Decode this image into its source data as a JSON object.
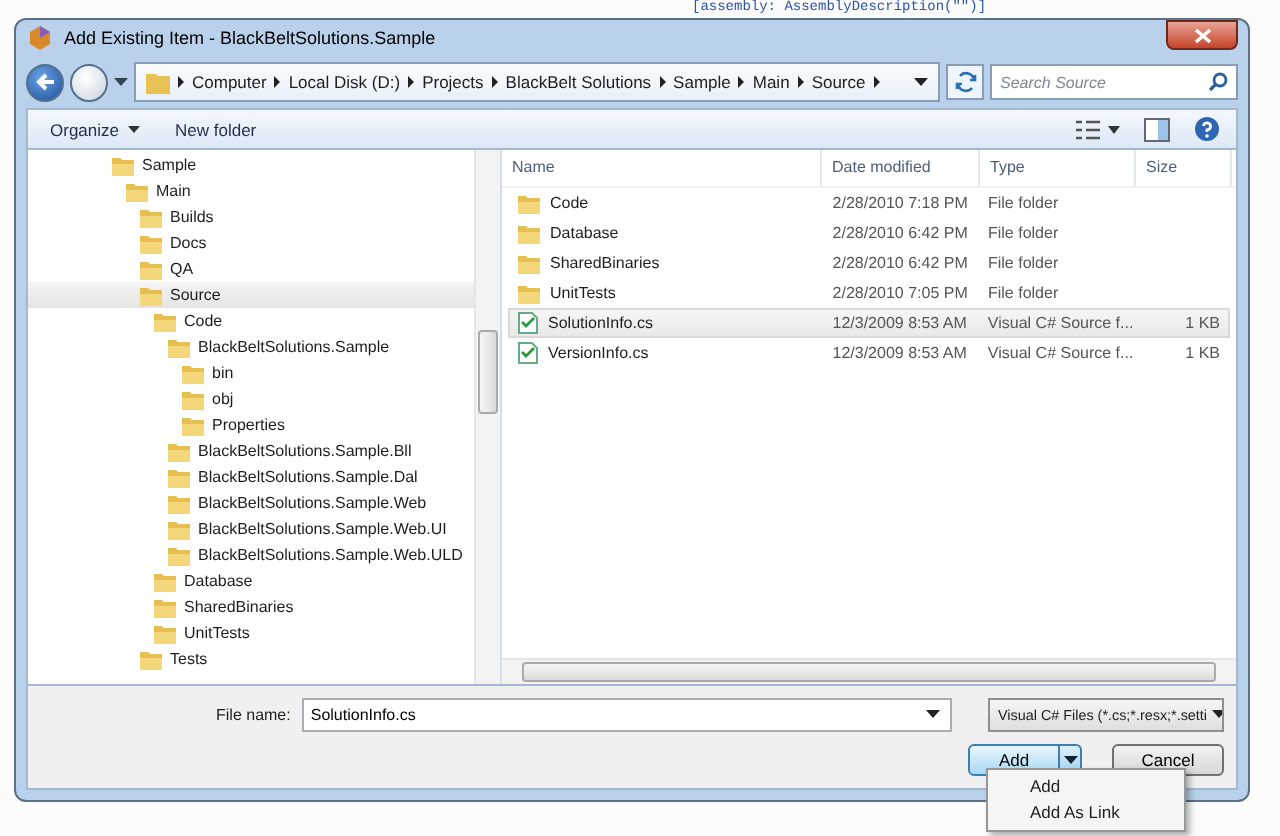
{
  "editor_line": "[assembly: AssemblyDescription(\"\")]",
  "window": {
    "title": "Add Existing Item - BlackBeltSolutions.Sample"
  },
  "breadcrumbs": [
    "Computer",
    "Local Disk (D:)",
    "Projects",
    "BlackBelt Solutions",
    "Sample",
    "Main",
    "Source"
  ],
  "search": {
    "placeholder": "Search Source"
  },
  "toolbar": [
    "Organize",
    "New folder"
  ],
  "tree": [
    {
      "label": "Sample",
      "selected": false,
      "children": [
        {
          "label": "Main",
          "selected": false,
          "children": [
            {
              "label": "Builds",
              "selected": false
            },
            {
              "label": "Docs",
              "selected": false
            },
            {
              "label": "QA",
              "selected": false
            },
            {
              "label": "Source",
              "selected": true,
              "children": [
                {
                  "label": "Code",
                  "selected": false,
                  "children": [
                    {
                      "label": "BlackBeltSolutions.Sample",
                      "selected": false,
                      "children": [
                        {
                          "label": "bin",
                          "selected": false
                        },
                        {
                          "label": "obj",
                          "selected": false
                        },
                        {
                          "label": "Properties",
                          "selected": false
                        }
                      ]
                    },
                    {
                      "label": "BlackBeltSolutions.Sample.Bll",
                      "selected": false
                    },
                    {
                      "label": "BlackBeltSolutions.Sample.Dal",
                      "selected": false
                    },
                    {
                      "label": "BlackBeltSolutions.Sample.Web",
                      "selected": false
                    },
                    {
                      "label": "BlackBeltSolutions.Sample.Web.UI",
                      "selected": false
                    },
                    {
                      "label": "BlackBeltSolutions.Sample.Web.ULD",
                      "selected": false
                    }
                  ]
                },
                {
                  "label": "Database",
                  "selected": false
                },
                {
                  "label": "SharedBinaries",
                  "selected": false
                },
                {
                  "label": "UnitTests",
                  "selected": false
                }
              ]
            },
            {
              "label": "Tests",
              "selected": false
            }
          ]
        }
      ]
    }
  ],
  "table": {
    "columns": [
      "Name",
      "Date modified",
      "Type",
      "Size"
    ],
    "rows": [
      {
        "kind": "folder",
        "name": "Code",
        "date": "2/28/2010 7:18 PM",
        "type": "File folder",
        "selected": false
      },
      {
        "kind": "folder",
        "name": "Database",
        "date": "2/28/2010 6:42 PM",
        "type": "File folder",
        "selected": false
      },
      {
        "kind": "folder",
        "name": "SharedBinaries",
        "date": "2/28/2010 6:42 PM",
        "type": "File folder",
        "selected": false
      },
      {
        "kind": "folder",
        "name": "UnitTests",
        "date": "2/28/2010 7:05 PM",
        "type": "File folder",
        "selected": false
      },
      {
        "kind": "csfile",
        "name": "SolutionInfo.cs",
        "date": "12/3/2009 8:53 AM",
        "type": "Visual C# Source f...",
        "size": "1 KB",
        "selected": true
      },
      {
        "kind": "csfile",
        "name": "VersionInfo.cs",
        "date": "12/3/2009 8:53 AM",
        "type": "Visual C# Source f...",
        "size": "1 KB",
        "selected": false
      }
    ]
  },
  "file_name": {
    "label": "File name:",
    "value": "SolutionInfo.cs"
  },
  "file_type": "Visual C# Files (*.cs;*.resx;*.setti",
  "buttons": [
    "Add",
    "Cancel"
  ],
  "add_menu": [
    "Add",
    "Add As Link"
  ]
}
